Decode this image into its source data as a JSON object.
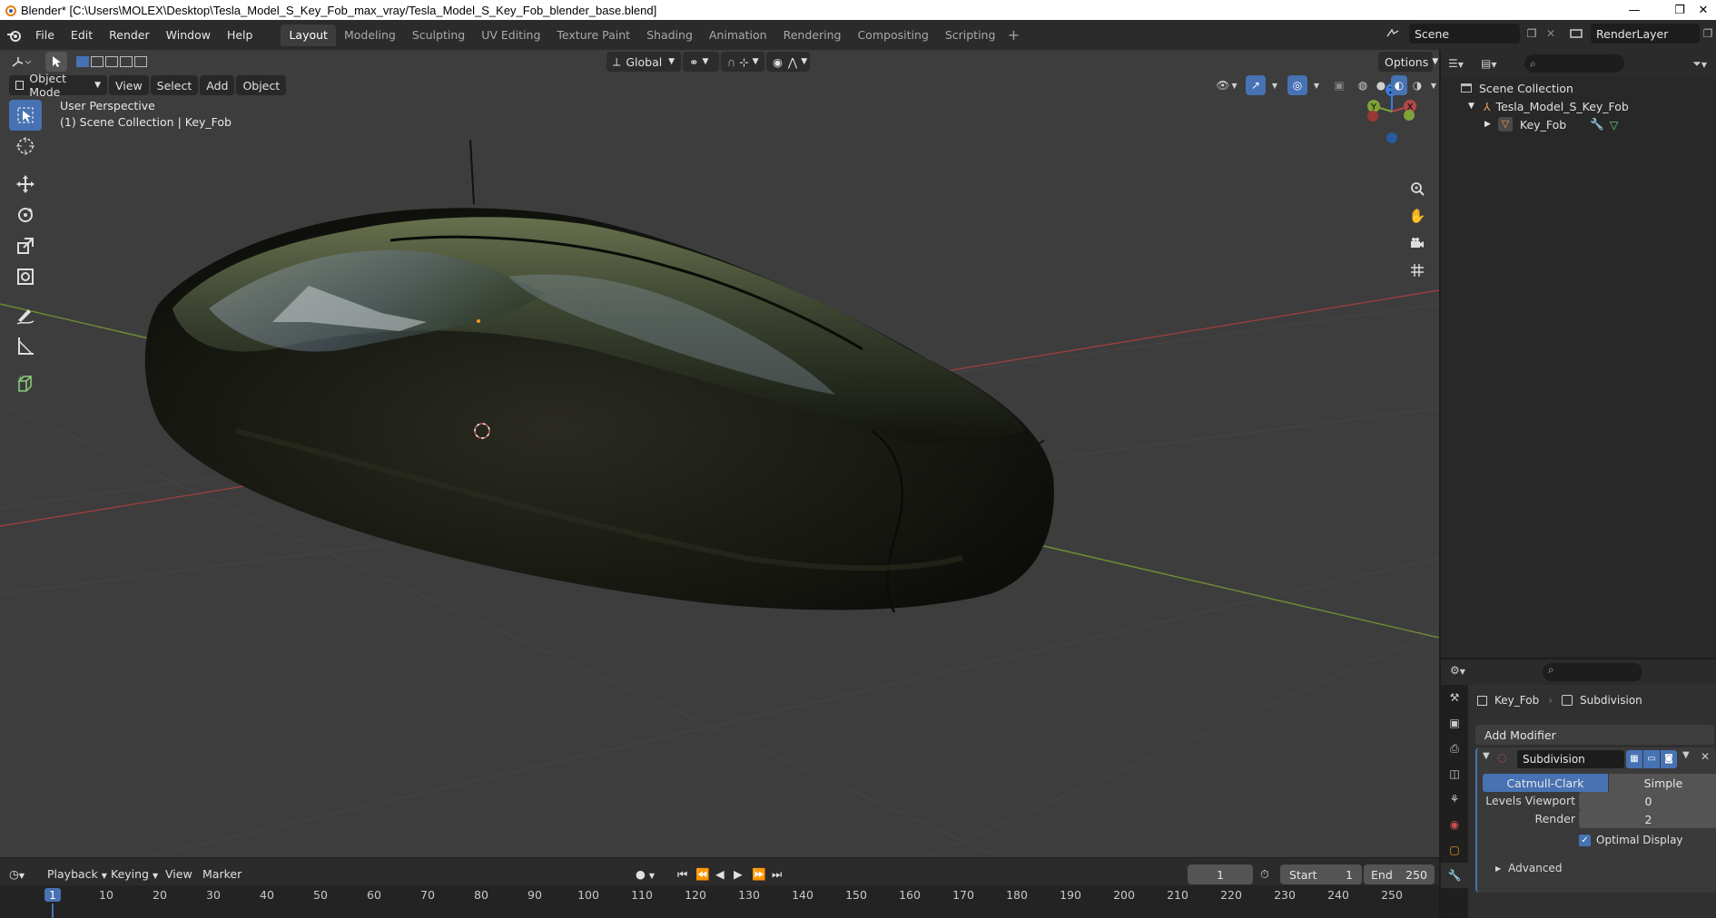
{
  "window": {
    "title": "Blender* [C:\\Users\\MOLEX\\Desktop\\Tesla_Model_S_Key_Fob_max_vray/Tesla_Model_S_Key_Fob_blender_base.blend]",
    "minimize": "—",
    "restore": "❐",
    "close": "✕"
  },
  "menu": [
    "File",
    "Edit",
    "Render",
    "Window",
    "Help"
  ],
  "workspaces": [
    "Layout",
    "Modeling",
    "Sculpting",
    "UV Editing",
    "Texture Paint",
    "Shading",
    "Animation",
    "Rendering",
    "Compositing",
    "Scripting"
  ],
  "active_workspace": "Layout",
  "scene": {
    "name": "Scene",
    "view_layer": "RenderLayer"
  },
  "viewport": {
    "mode": "Object Mode",
    "menus": [
      "View",
      "Select",
      "Add",
      "Object"
    ],
    "transform_orientation": "Global",
    "options_label": "Options",
    "overlay_title": "User Perspective",
    "overlay_collection": "(1) Scene Collection | Key_Fob",
    "gizmo_axes": {
      "z": "Z",
      "y": "Y",
      "x": "X"
    },
    "colors": {
      "background": "#3d3d3d",
      "x_axis": "#b34848",
      "y_axis": "#7fa13a",
      "z_axis": "#3b7be2",
      "active": "#4772b3"
    }
  },
  "tools": [
    "select-box",
    "cursor",
    "move",
    "rotate",
    "scale",
    "transform",
    "annotate",
    "measure",
    "add-cube"
  ],
  "timeline": {
    "menus": [
      "Playback",
      "Keying",
      "View",
      "Marker"
    ],
    "current_frame": "1",
    "start_label": "Start",
    "start": "1",
    "end_label": "End",
    "end": "250",
    "ruler": [
      "1",
      "10",
      "20",
      "30",
      "40",
      "50",
      "60",
      "70",
      "80",
      "90",
      "100",
      "110",
      "120",
      "130",
      "140",
      "150",
      "160",
      "170",
      "180",
      "190",
      "200",
      "210",
      "220",
      "230",
      "240",
      "250"
    ]
  },
  "outliner": {
    "root": "Scene Collection",
    "collection": "Tesla_Model_S_Key_Fob",
    "object": "Key_Fob"
  },
  "properties": {
    "breadcrumb_object": "Key_Fob",
    "breadcrumb_modifier": "Subdivision",
    "add_modifier": "Add Modifier",
    "modifier_name": "Subdivision",
    "type_catmull": "Catmull-Clark",
    "type_simple": "Simple",
    "levels_viewport_label": "Levels Viewport",
    "levels_viewport": "0",
    "render_label": "Render",
    "render": "2",
    "optimal_display_label": "Optimal Display",
    "optimal_display": true,
    "advanced_label": "Advanced"
  }
}
